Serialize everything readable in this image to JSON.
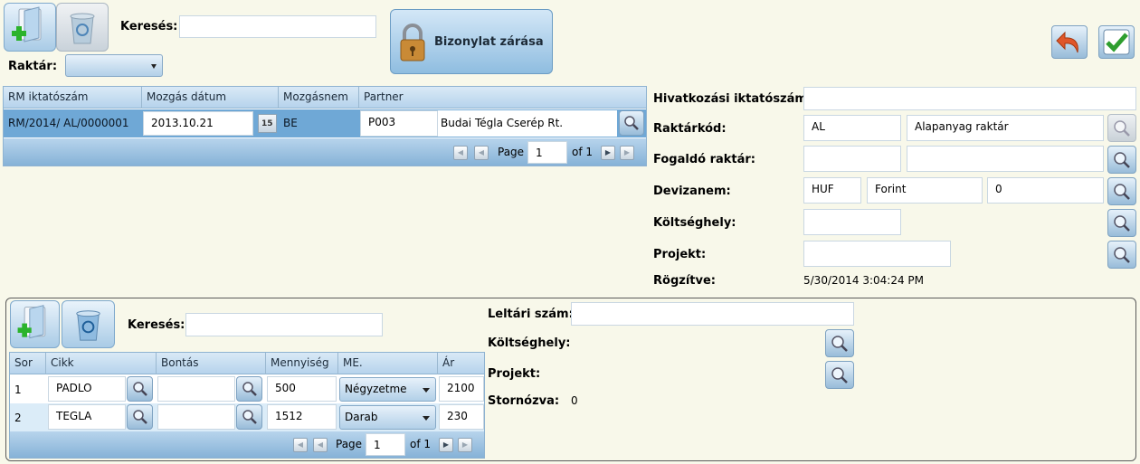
{
  "toolbar": {
    "search_label": "Keresés:",
    "search_value": "",
    "close_document_label": "Bizonylat zárása",
    "warehouse_label": "Raktár:",
    "warehouse_value": ""
  },
  "movements_grid": {
    "columns": [
      "RM iktatószám",
      "Mozgás dátum",
      "Mozgásnem",
      "Partner"
    ],
    "row": {
      "number": "RM/2014/  AL/0000001",
      "date": "2013.10.21",
      "calendar_day": "15",
      "type": "BE",
      "partner_code": "P003",
      "partner_name": "Budai Tégla Cserép Rt."
    },
    "pager": {
      "page_label": "Page",
      "page_value": "1",
      "of_label": "of 1"
    }
  },
  "details": {
    "ref_label": "Hivatkozási iktatószám:",
    "ref_value": "",
    "warehouse_code_label": "Raktárkód:",
    "warehouse_code": "AL",
    "warehouse_name": "Alapanyag raktár",
    "receiving_label": "Fogaldó raktár:",
    "currency_label": "Devizanem:",
    "currency_code": "HUF",
    "currency_name": "Forint",
    "currency_rate": "0",
    "cost_center_label": "Költséghely:",
    "project_label": "Projekt:",
    "recorded_label": "Rögzítve:",
    "recorded_value": "5/30/2014 3:04:24 PM"
  },
  "items": {
    "search_label": "Keresés:",
    "search_value": "",
    "columns": [
      "Sor",
      "Cikk",
      "Bontás",
      "Mennyiség",
      "ME.",
      "Ár"
    ],
    "rows": [
      {
        "sor": "1",
        "cikk": "PADLO",
        "bontas": "",
        "mennyiseg": "500",
        "me": "Négyzetme",
        "ar": "2100"
      },
      {
        "sor": "2",
        "cikk": "TEGLA",
        "bontas": "",
        "mennyiseg": "1512",
        "me": "Darab",
        "ar": "230"
      }
    ],
    "pager": {
      "page_label": "Page",
      "page_value": "1",
      "of_label": "of 1"
    }
  },
  "item_details": {
    "inventory_label": "Leltári szám:",
    "inventory_value": "",
    "cost_center_label": "Költséghely:",
    "project_label": "Projekt:",
    "storno_label": "Stornózva:",
    "storno_value": "0"
  },
  "colors": {
    "background": "#f8f8ea",
    "grid_header": "#c4dbef",
    "selected_row": "#6fa8d6",
    "accent_green": "#2e9e2e",
    "undo_orange": "#e0562a"
  }
}
